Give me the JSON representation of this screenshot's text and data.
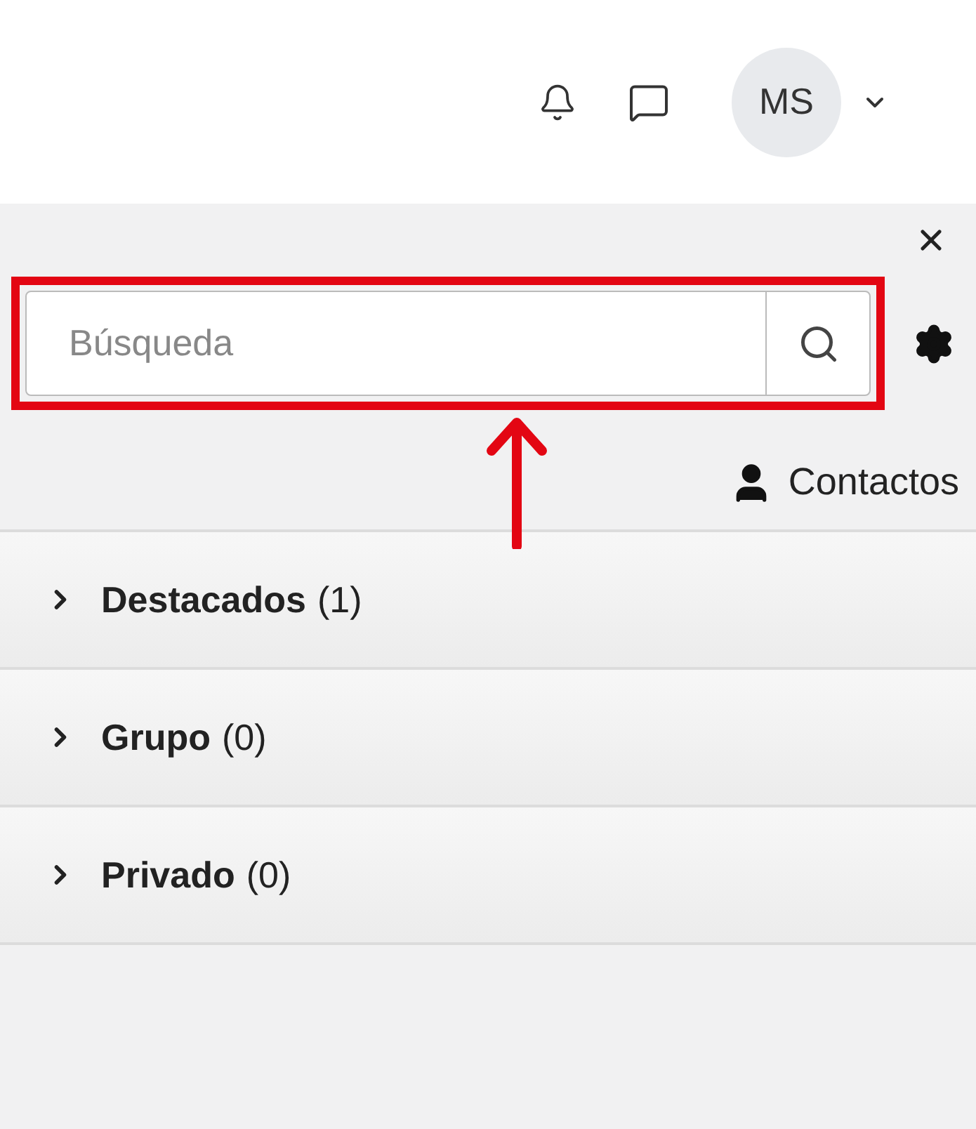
{
  "header": {
    "avatar_initials": "MS"
  },
  "panel": {
    "search": {
      "placeholder": "Búsqueda"
    },
    "contacts_label": "Contactos",
    "groups": [
      {
        "title": "Destacados",
        "count": "(1)",
        "expanded": false
      },
      {
        "title": "Grupo",
        "count": "(0)",
        "expanded": false
      },
      {
        "title": "Privado",
        "count": "(0)",
        "expanded": false
      }
    ]
  }
}
